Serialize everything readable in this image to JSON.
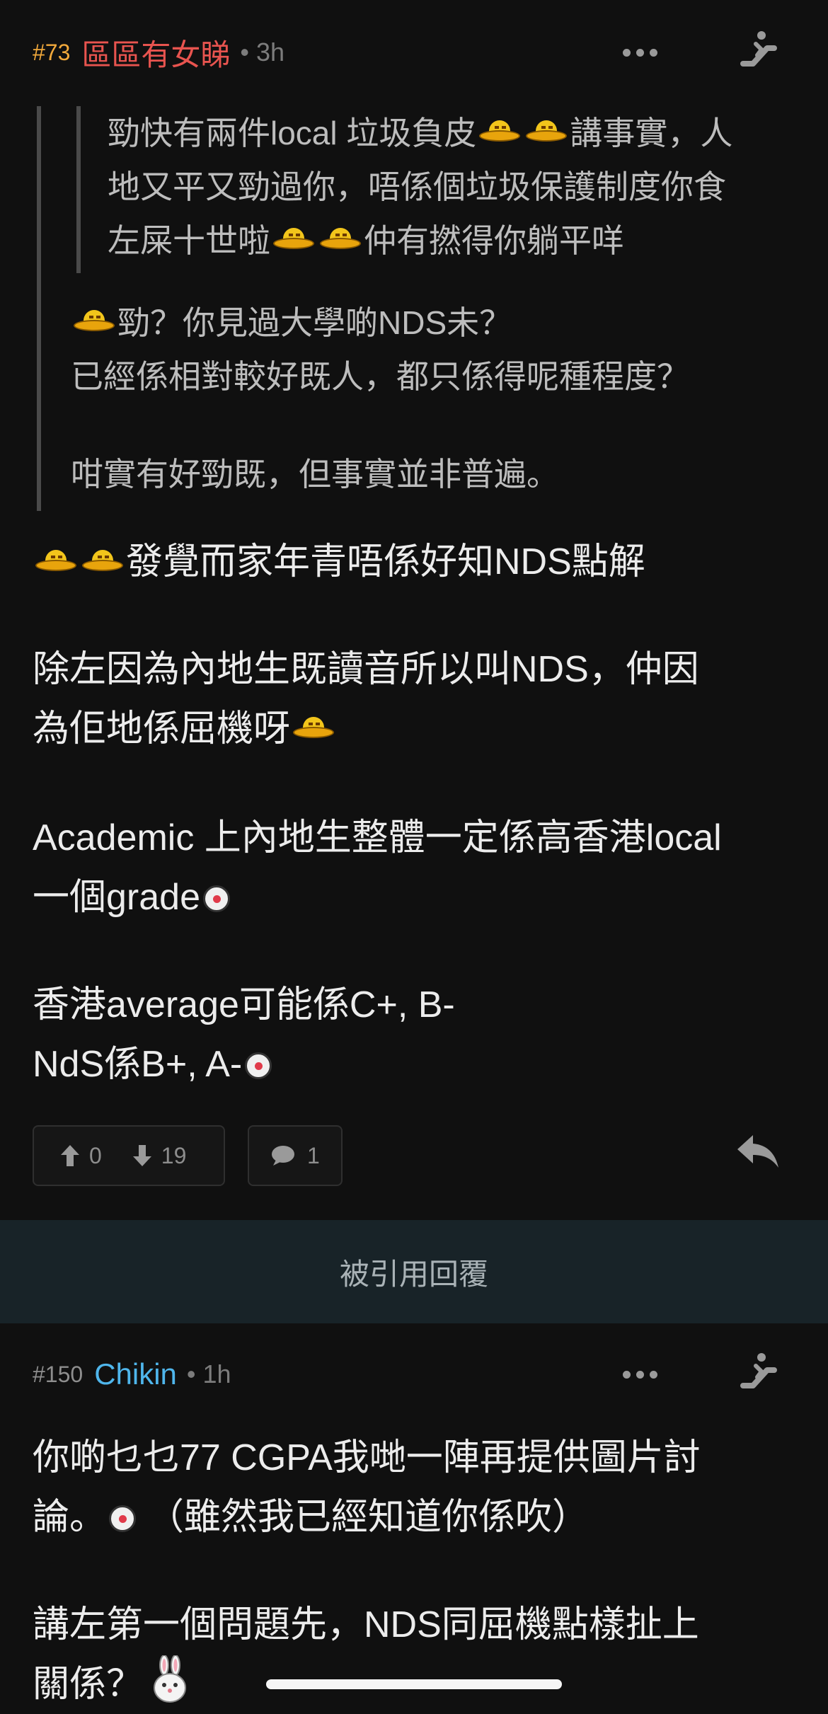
{
  "post73": {
    "number": "#73",
    "author": "區區有女睇",
    "time": "• 3h",
    "quote_inner": [
      "勁快有兩件local 垃圾負皮",
      "講事實，人",
      "地又平又勁過你，唔係個垃圾保護制度你食",
      "左屎十世啦",
      "仲有撚得你躺平咩"
    ],
    "quote_outer": [
      "勁？你見過大學啲NDS未？",
      "已經係相對較好既人，都只係得呢種程度？",
      "咁實有好勁既，但事實並非普遍。"
    ],
    "body": [
      "發覺而家年青唔係好知NDS點解",
      "除左因為內地生既讀音所以叫NDS，仲因",
      "為佢地係屈機呀",
      "Academic 上內地生整體一定係高香港local",
      "一個grade",
      "香港average可能係C+, B-",
      "NdS係B+, A-"
    ],
    "upvotes": "0",
    "downvotes": "19",
    "comments": "1"
  },
  "quoted_reply_label": "被引用回覆",
  "post150": {
    "number": "#150",
    "author": "Chikin",
    "time": "• 1h",
    "body": [
      "你啲乜乜77 CGPA我哋一陣再提供圖片討",
      "論。",
      "（雖然我已經知道你係吹）",
      "講左第一個問題先，NDS同屈機點樣扯上",
      "關係？"
    ]
  },
  "icons": [
    "more-icon",
    "escalator-icon",
    "upvote-icon",
    "downvote-icon",
    "comment-icon",
    "reply-icon"
  ],
  "colors": {
    "author_red": "#e8544f",
    "author_blue": "#4fb6ec",
    "post_number_orange": "#f2a93b",
    "background": "#101010"
  }
}
